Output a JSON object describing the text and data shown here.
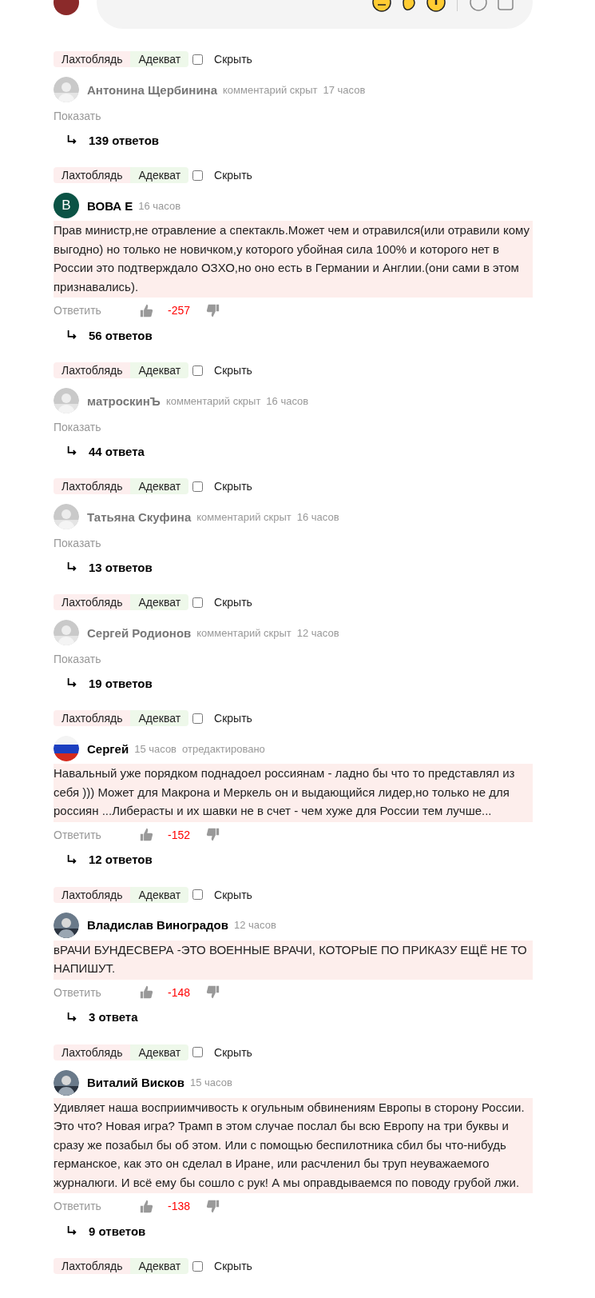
{
  "comments": [
    {
      "kind": "hidden",
      "tags": [
        {
          "label": "Лахтоблядь",
          "color": "#fdeeee"
        },
        {
          "label": "Адекват",
          "color": "#eef8ea"
        }
      ],
      "checked": false,
      "hide_label": "Скрыть",
      "author": "Антонина Щербинина",
      "status": "комментарий скрыт",
      "time": "17 часов",
      "show_label": "Показать",
      "replies": "139 ответов"
    },
    {
      "kind": "visible",
      "tags": [
        {
          "label": "Лахтоблядь",
          "color": "#fdeeee"
        },
        {
          "label": "Адекват",
          "color": "#eef8ea"
        }
      ],
      "checked": false,
      "hide_label": "Скрыть",
      "avatar": {
        "kind": "letter",
        "letter": "В",
        "color": "#0b5345"
      },
      "author": "ВОВА Е",
      "time": "16 часов",
      "text": "Прав министр,не отравление а спектакль.Может чем и отравился(или отравили кому выгодно) но только не новичком,у которого убойная сила 100% и которого нет в России это подтверждало ОЗХО,но оно есть в Германии и Англии.(они сами в этом признавались).",
      "reply_label": "Ответить",
      "score": "-257",
      "replies": "56 ответов"
    },
    {
      "kind": "hidden",
      "tags": [
        {
          "label": "Лахтоблядь",
          "color": "#fdeeee"
        },
        {
          "label": "Адекват",
          "color": "#eef8ea"
        }
      ],
      "checked": false,
      "hide_label": "Скрыть",
      "author": "матроскинЪ",
      "status": "комментарий скрыт",
      "time": "16 часов",
      "show_label": "Показать",
      "replies": "44 ответа"
    },
    {
      "kind": "hidden",
      "tags": [
        {
          "label": "Лахтоблядь",
          "color": "#fdeeee"
        },
        {
          "label": "Адекват",
          "color": "#eef8ea"
        }
      ],
      "checked": false,
      "hide_label": "Скрыть",
      "author": "Татьяна Скуфина",
      "status": "комментарий скрыт",
      "time": "16 часов",
      "show_label": "Показать",
      "replies": "13 ответов"
    },
    {
      "kind": "hidden",
      "tags": [
        {
          "label": "Лахтоблядь",
          "color": "#fdeeee"
        },
        {
          "label": "Адекват",
          "color": "#eef8ea"
        }
      ],
      "checked": false,
      "hide_label": "Скрыть",
      "author": "Сергей Родионов",
      "status": "комментарий скрыт",
      "time": "12 часов",
      "show_label": "Показать",
      "replies": "19 ответов"
    },
    {
      "kind": "visible",
      "tags": [
        {
          "label": "Лахтоблядь",
          "color": "#fdeeee"
        },
        {
          "label": "Адекват",
          "color": "#eef8ea"
        }
      ],
      "checked": false,
      "hide_label": "Скрыть",
      "avatar": {
        "kind": "flag"
      },
      "author": "Сергей",
      "time": "15 часов",
      "edited": "отредактировано",
      "text": "Навальный уже порядком поднадоел россиянам - ладно бы что то представлял из себя ))) Может для Макрона и Меркель он и выдающийся лидер,но только не для россиян ...Либерасты и их шавки не в счет - чем хуже для России тем лучше...",
      "reply_label": "Ответить",
      "score": "-152",
      "replies": "12 ответов"
    },
    {
      "kind": "visible",
      "tags": [
        {
          "label": "Лахтоблядь",
          "color": "#fdeeee"
        },
        {
          "label": "Адекват",
          "color": "#eef8ea"
        }
      ],
      "checked": false,
      "hide_label": "Скрыть",
      "author": "Владислав Виноградов",
      "time": "12 часов",
      "text": "вРАЧИ БУНДЕСВЕРА -ЭТО ВОЕННЫЕ ВРАЧИ, КОТОРЫЕ ПО ПРИКАЗУ ЕЩЁ НЕ ТО НАПИШУТ.",
      "reply_label": "Ответить",
      "score": "-148",
      "replies": "3 ответа"
    },
    {
      "kind": "visible",
      "tags": [
        {
          "label": "Лахтоблядь",
          "color": "#fdeeee"
        },
        {
          "label": "Адекват",
          "color": "#eef8ea"
        }
      ],
      "checked": false,
      "hide_label": "Скрыть",
      "author": "Виталий Висков",
      "time": "15 часов",
      "text": "Удивляет наша восприимчивость к огульным обвинениям Европы в сторону России. Это что? Новая игра? Трамп в этом случае послал бы всю Европу на три буквы и сразу же позабыл бы об этом. Или с помощью беспилотника сбил бы что-нибудь германское, как это он сделал в Иране, или расчленил бы труп неуважаемого журналюги. И всё ему бы сошло с рук! А мы оправдываемся по поводу грубой лжи.",
      "reply_label": "Ответить",
      "score": "-138",
      "replies": "9 ответов"
    },
    {
      "kind": "cut",
      "tags": [
        {
          "label": "Лахтоблядь",
          "color": "#fdeeee"
        },
        {
          "label": "Адекват",
          "color": "#eef8ea"
        }
      ],
      "checked": false,
      "hide_label": "Скрыть"
    }
  ]
}
